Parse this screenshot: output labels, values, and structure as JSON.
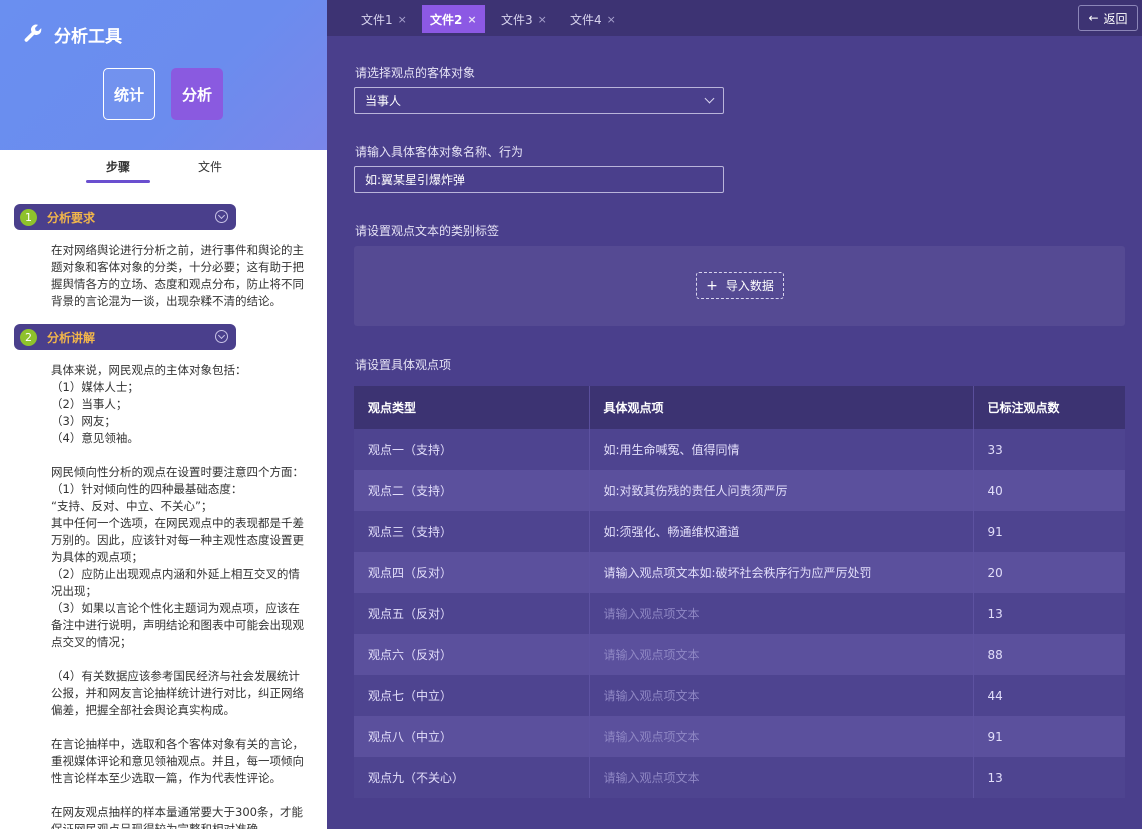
{
  "sidebar": {
    "app_title": "分析工具",
    "mode_stat": "统计",
    "mode_analysis": "分析",
    "tab_steps": "步骤",
    "tab_files": "文件",
    "steps": [
      {
        "num": "1",
        "label": "分析要求",
        "text": "在对网络舆论进行分析之前，进行事件和舆论的主题对象和客体对象的分类，十分必要；这有助于把握舆情各方的立场、态度和观点分布，防止将不同背景的言论混为一谈，出现杂糅不清的结论。"
      },
      {
        "num": "2",
        "label": "分析讲解",
        "text": "具体来说，网民观点的主体对象包括：\n（1）媒体人士；\n（2）当事人；\n（3）网友；\n（4）意见领袖。\n\n网民倾向性分析的观点在设置时要注意四个方面：\n（1）针对倾向性的四种最基础态度：\n“支持、反对、中立、不关心”；\n其中任何一个选项，在网民观点中的表现都是千差万别的。因此，应该针对每一种主观性态度设置更为具体的观点项；\n（2）应防止出现观点内涵和外延上相互交叉的情况出现；\n（3）如果以言论个性化主题词为观点项，应该在备注中进行说明，声明结论和图表中可能会出现观点交叉的情况；\n\n（4）有关数据应该参考国民经济与社会发展统计公报，并和网友言论抽样统计进行对比，纠正网络偏差，把握全部社会舆论真实构成。\n\n在言论抽样中，选取和各个客体对象有关的言论，重视媒体评论和意见领袖观点。并且，每一项倾向性言论样本至少选取一篇，作为代表性评论。\n\n在网友观点抽样的样本量通常要大于300条，才能保证网民观点呈现得较为完整和相对准确。"
      }
    ]
  },
  "tabs": [
    {
      "label": "文件1",
      "close": "×"
    },
    {
      "label": "文件2",
      "close": "×"
    },
    {
      "label": "文件3",
      "close": "×"
    },
    {
      "label": "文件4",
      "close": "×"
    }
  ],
  "back_label": "返回",
  "form": {
    "object_label": "请选择观点的客体对象",
    "object_value": "当事人",
    "name_label": "请输入具体客体对象名称、行为",
    "name_placeholder": "如:翼某星引爆炸弹",
    "category_label": "请设置观点文本的类别标签",
    "import_label": "导入数据",
    "items_label": "请设置具体观点项"
  },
  "table": {
    "headers": [
      "观点类型",
      "具体观点项",
      "已标注观点数"
    ],
    "rows": [
      {
        "type": "观点一（支持）",
        "item": "如:用生命喊冤、值得同情",
        "count": "33",
        "placeholder": false
      },
      {
        "type": "观点二（支持）",
        "item": "如:对致其伤残的责任人问责须严厉",
        "count": "40",
        "placeholder": false
      },
      {
        "type": "观点三（支持）",
        "item": "如:须强化、畅通维权通道",
        "count": "91",
        "placeholder": false
      },
      {
        "type": "观点四（反对）",
        "item": "请输入观点项文本如:破坏社会秩序行为应严厉处罚",
        "count": "20",
        "placeholder": false
      },
      {
        "type": "观点五（反对）",
        "item": "请输入观点项文本",
        "count": "13",
        "placeholder": true
      },
      {
        "type": "观点六（反对）",
        "item": "请输入观点项文本",
        "count": "88",
        "placeholder": true
      },
      {
        "type": "观点七（中立）",
        "item": "请输入观点项文本",
        "count": "44",
        "placeholder": true
      },
      {
        "type": "观点八（中立）",
        "item": "请输入观点项文本",
        "count": "91",
        "placeholder": true
      },
      {
        "type": "观点九（不关心）",
        "item": "请输入观点项文本",
        "count": "13",
        "placeholder": true
      }
    ]
  }
}
